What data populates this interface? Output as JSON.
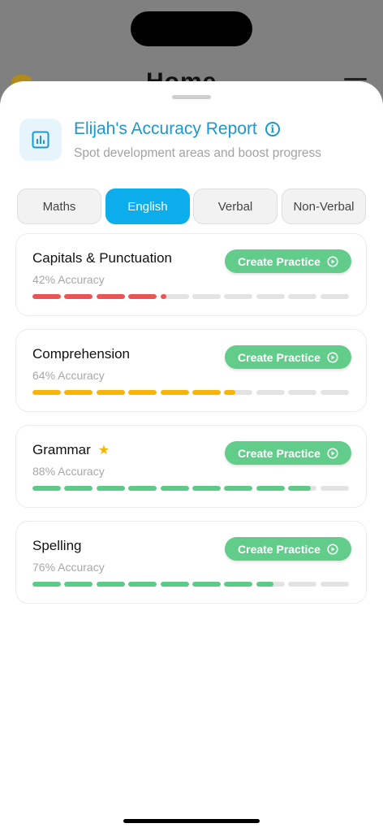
{
  "background": {
    "title": "Home"
  },
  "header": {
    "title": "Elijah's Accuracy Report",
    "subtitle": "Spot development areas and boost progress",
    "icon": "bar-chart-icon",
    "accent": "#1d97cf"
  },
  "tabs": [
    {
      "label": "Maths",
      "active": false
    },
    {
      "label": "English",
      "active": true
    },
    {
      "label": "Verbal",
      "active": false
    },
    {
      "label": "Non-Verbal",
      "active": false
    }
  ],
  "topics": [
    {
      "name": "Capitals & Punctuation",
      "accuracy_text": "42% Accuracy",
      "accuracy": 42,
      "color": "#ea5455",
      "starred": false,
      "button": "Create Practice"
    },
    {
      "name": "Comprehension",
      "accuracy_text": "64% Accuracy",
      "accuracy": 64,
      "color": "#f8b407",
      "starred": false,
      "button": "Create Practice"
    },
    {
      "name": "Grammar",
      "accuracy_text": "88% Accuracy",
      "accuracy": 88,
      "color": "#5ccb88",
      "starred": true,
      "button": "Create Practice"
    },
    {
      "name": "Spelling",
      "accuracy_text": "76% Accuracy",
      "accuracy": 76,
      "color": "#5ccb88",
      "starred": false,
      "button": "Create Practice"
    }
  ]
}
